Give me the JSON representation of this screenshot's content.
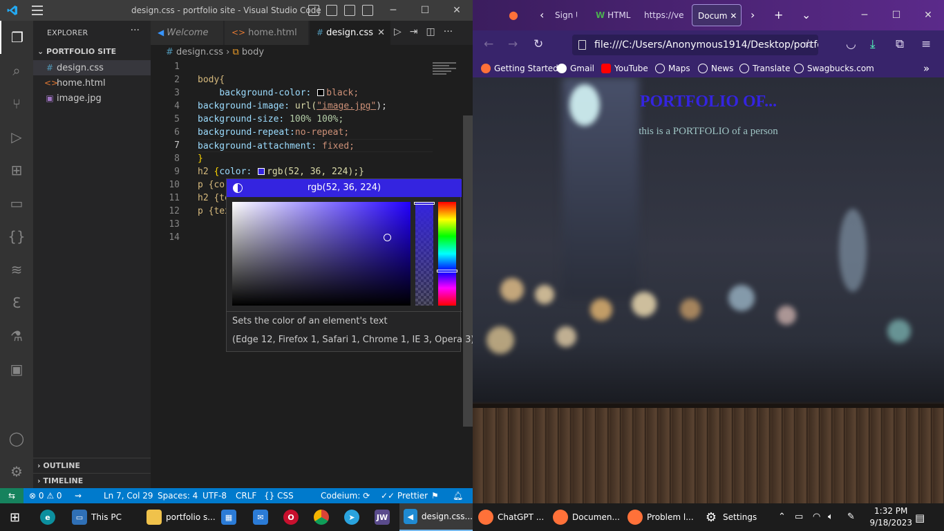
{
  "vscode": {
    "title": "design.css - portfolio site - Visual Studio Code",
    "explorer_label": "EXPLORER",
    "folder": "PORTFOLIO SITE",
    "files": [
      "design.css",
      "home.html",
      "image.jpg"
    ],
    "outline_label": "OUTLINE",
    "timeline_label": "TIMELINE",
    "tabs": [
      "Welcome",
      "home.html",
      "design.css"
    ],
    "breadcrumb_file": "design.css",
    "breadcrumb_symbol": "body",
    "line_numbers": [
      "1",
      "2",
      "3",
      "4",
      "5",
      "6",
      "7",
      "8",
      "9",
      "10",
      "11",
      "12",
      "13",
      "14"
    ],
    "code_lines": {
      "l2": "body{",
      "l3_prop": "background-color:",
      "l3_val": "black;",
      "l4_prop": "background-image:",
      "l4_fn": "url(",
      "l4_str": "\"image.jpg\"",
      "l4_end": ");",
      "l5_prop": "background-size:",
      "l5_val": "100% 100%;",
      "l6_prop": "background-repeat:",
      "l6_val": "no-repeat;",
      "l7_prop": "background-attachment:",
      "l7_val": "fixed;",
      "l8": "}",
      "l9_sel": "h2",
      "l9_prop": "color:",
      "l9_val": "rgb(52, 36, 224);}",
      "l10": "p {co",
      "l11": "h2 {te",
      "l12": "p {tex"
    },
    "color_picker": {
      "value": "rgb(52, 36, 224)",
      "color": "#3424e0",
      "description": "Sets the color of an element's text",
      "compatibility": "(Edge 12, Firefox 1, Safari 1, Chrome 1, IE 3, Opera 3)"
    },
    "status": {
      "problems": "⊗ 0 ⚠ 0",
      "position": "Ln 7, Col 29",
      "spaces": "Spaces: 4",
      "encoding": "UTF-8",
      "eol": "CRLF",
      "language": "CSS",
      "codeium": "Codeium:",
      "prettier": "Prettier"
    }
  },
  "firefox": {
    "tabs": [
      "Sign U",
      "HTML",
      "https://ve",
      "Docum"
    ],
    "url": "file:///C:/Users/Anonymous1914/Desktop/portfo",
    "bookmarks": [
      "Getting Started",
      "Gmail",
      "YouTube",
      "Maps",
      "News",
      "Translate",
      "Swagbucks.com"
    ],
    "page_heading": "PORTFOLIO OF...",
    "page_paragraph": "this is a PORTFOLIO of a person"
  },
  "taskbar": {
    "items": [
      "This PC",
      "portfolio s...",
      "design.css...",
      "ChatGPT ...",
      "Documen...",
      "Problem l...",
      "Settings"
    ],
    "time": "1:32 PM",
    "date": "9/18/2023"
  }
}
